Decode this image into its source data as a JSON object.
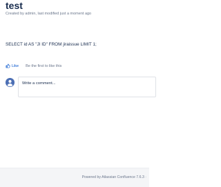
{
  "page": {
    "title": "test",
    "byline": "Created by admin, last modified just a moment ago"
  },
  "content": {
    "text": "SELECT id AS \"JI ID\" FROM jiraissue LIMIT 1;"
  },
  "likes": {
    "like_label": "Like",
    "summary": "Be the first to like this",
    "icon": "thumbs-up-icon"
  },
  "comment": {
    "placeholder": "Write a comment...",
    "avatar_icon": "default-user-avatar-icon"
  },
  "footer": {
    "text": "Powered by Atlassian Confluence 7.6.3 ·"
  },
  "colors": {
    "link": "#0052cc",
    "text": "#172b4d",
    "muted": "#6b778c",
    "footer_bg": "#f4f5f7",
    "avatar_bg": "#4c6fb4"
  }
}
